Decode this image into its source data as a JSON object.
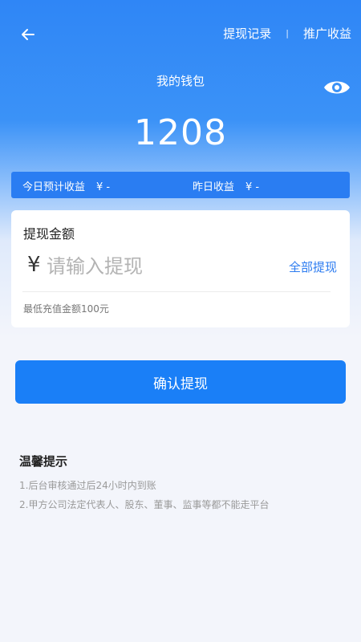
{
  "header": {
    "withdraw_records": "提现记录",
    "separator": "|",
    "promo_earnings": "推广收益",
    "wallet_title": "我的钱包",
    "balance": "1208"
  },
  "earnings": {
    "today_label": "今日预计收益",
    "today_value": "¥ -",
    "yesterday_label": "昨日收益",
    "yesterday_value": "¥ -"
  },
  "withdraw_card": {
    "title": "提现金额",
    "currency_symbol": "¥",
    "amount_value": "",
    "amount_placeholder": "请输入提现",
    "all_withdraw": "全部提现",
    "min_note": "最低充值金额100元"
  },
  "confirm_button": "确认提现",
  "tips": {
    "title": "温馨提示",
    "items": [
      "1.后台审核通过后24小时内到账",
      "2.甲方公司法定代表人、股东、董事、监事等都不能走平台"
    ]
  },
  "colors": {
    "primary": "#1a7ff7",
    "header_gradient_top": "#2f86f6",
    "link_blue": "#2d7cf0",
    "background": "#f3f5fb"
  },
  "icons": {
    "back": "back-arrow-icon",
    "eye": "eye-icon"
  }
}
